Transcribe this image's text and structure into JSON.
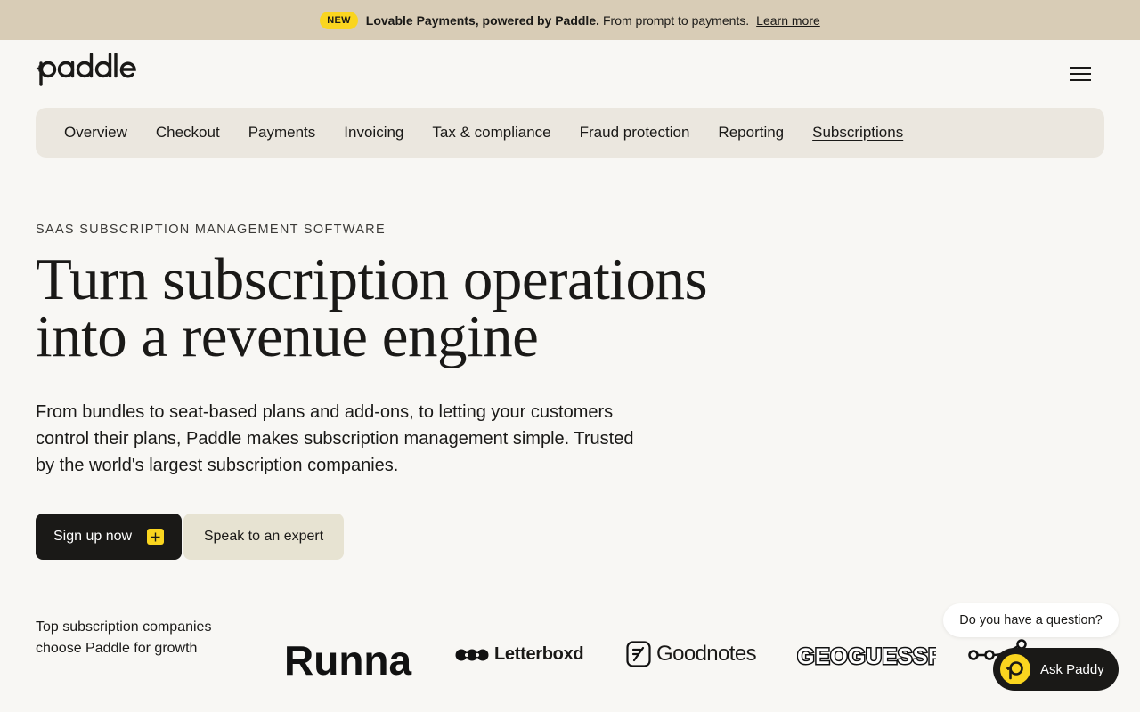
{
  "announcement": {
    "badge": "NEW",
    "strong": "Lovable Payments, powered by Paddle.",
    "rest": "From prompt to payments.",
    "link": "Learn more"
  },
  "header": {
    "logo_text": "paddle",
    "menu_icon": "hamburger-icon"
  },
  "subnav": {
    "items": [
      {
        "label": "Overview",
        "active": false
      },
      {
        "label": "Checkout",
        "active": false
      },
      {
        "label": "Payments",
        "active": false
      },
      {
        "label": "Invoicing",
        "active": false
      },
      {
        "label": "Tax & compliance",
        "active": false
      },
      {
        "label": "Fraud protection",
        "active": false
      },
      {
        "label": "Reporting",
        "active": false
      },
      {
        "label": "Subscriptions",
        "active": true
      }
    ]
  },
  "hero": {
    "eyebrow": "SAAS SUBSCRIPTION MANAGEMENT SOFTWARE",
    "headline_line1": "Turn subscription operations",
    "headline_line2": "into a revenue engine",
    "lede": "From bundles to seat-based plans and add-ons, to letting your customers control their plans, Paddle makes subscription management simple. Trusted by the world's largest subscription companies.",
    "primary_cta": "Sign up now",
    "secondary_cta": "Speak to an expert"
  },
  "logos": {
    "caption": "Top subscription companies choose Paddle for growth",
    "items": [
      "Runna",
      "Letterboxd",
      "Goodnotes",
      "GEOGUESSR"
    ]
  },
  "chat": {
    "bubble": "Do you have a question?",
    "button": "Ask Paddy"
  },
  "colors": {
    "background": "#f8f7f4",
    "announcement_bg": "#d8ccb6",
    "accent_yellow": "#fad51f",
    "dark": "#1a1917",
    "subnav_bg": "#ebe7df",
    "secondary_button_bg": "#e7e3d2"
  }
}
